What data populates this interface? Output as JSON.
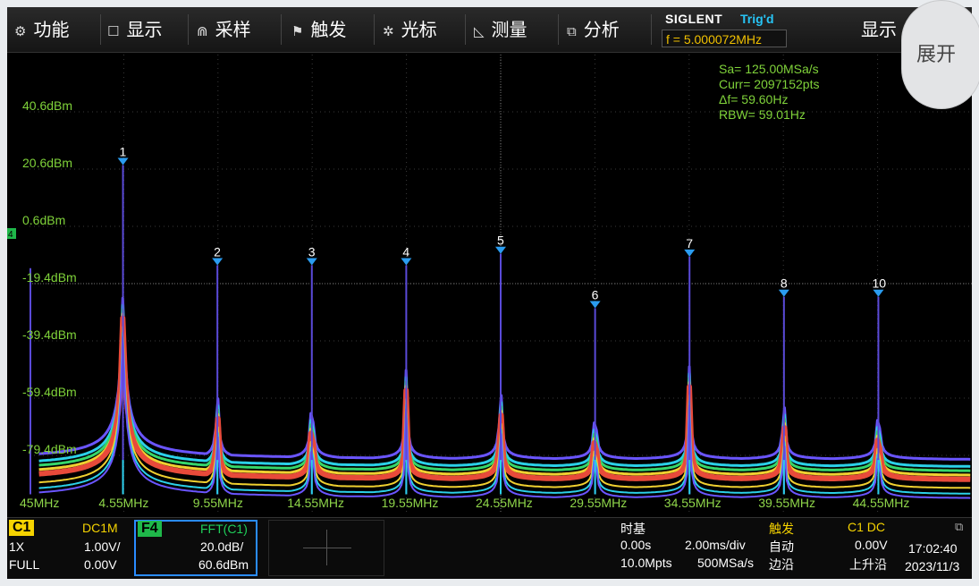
{
  "menu": {
    "items": [
      {
        "key": "function",
        "icon": "⚙",
        "label": "功能"
      },
      {
        "key": "display",
        "icon": "☐",
        "label": "显示"
      },
      {
        "key": "acquire",
        "icon": "⋒",
        "label": "采样"
      },
      {
        "key": "trigger",
        "icon": "⚑",
        "label": "触发"
      },
      {
        "key": "cursor",
        "icon": "✲",
        "label": "光标"
      },
      {
        "key": "measure",
        "icon": "◺",
        "label": "测量"
      },
      {
        "key": "analysis",
        "icon": "⧉",
        "label": "分析"
      }
    ],
    "brand": "SIGLENT",
    "trig_status": "Trig'd",
    "frequency": "f = 5.000072MHz",
    "right_label": "显示",
    "expand_label": "展开"
  },
  "fft_info": [
    "Sa= 125.00MSa/s",
    "Curr= 2097152pts",
    "Δf= 59.60Hz",
    "RBW= 59.01Hz"
  ],
  "channel_marker": "4",
  "chart_data": {
    "type": "line",
    "title": "",
    "y_labels": [
      "40.6dBm",
      "20.6dBm",
      "0.6dBm",
      "-19.4dBm",
      "-39.4dBm",
      "-59.4dBm",
      "-79.4dBm"
    ],
    "x_labels": [
      "45MHz",
      "4.55MHz",
      "9.55MHz",
      "14.55MHz",
      "19.55MHz",
      "24.55MHz",
      "29.55MHz",
      "34.55MHz",
      "39.55MHz",
      "44.55MHz"
    ],
    "ylim": [
      -99.4,
      60.6
    ],
    "xlim": [
      0.05,
      49.95
    ],
    "grid": true,
    "noise_floor_dbm": -87,
    "peaks": [
      {
        "n": "1",
        "x": 5.0,
        "y": 22
      },
      {
        "n": "2",
        "x": 10.0,
        "y": -13
      },
      {
        "n": "3",
        "x": 15.0,
        "y": -13
      },
      {
        "n": "4",
        "x": 20.0,
        "y": -13
      },
      {
        "n": "5",
        "x": 25.0,
        "y": -9
      },
      {
        "n": "6",
        "x": 30.0,
        "y": -28
      },
      {
        "n": "7",
        "x": 35.0,
        "y": -10
      },
      {
        "n": "8",
        "x": 40.0,
        "y": -24
      },
      {
        "n": "10",
        "x": 45.0,
        "y": -24
      }
    ],
    "colors": {
      "trace_low": "#e84a3a",
      "trace_mid": "#f0d030",
      "trace_green": "#36d66a",
      "trace_cyan": "#2bd0e8",
      "trace_top": "#6a55ff",
      "peak": "#5a4ad8",
      "marker": "#2a9cf0"
    }
  },
  "status": {
    "c1": {
      "tag": "C1",
      "coupling": "DC1M",
      "probe": "1X",
      "scale": "1.00V/",
      "bw": "FULL",
      "offset": "0.00V"
    },
    "f4": {
      "tag": "F4",
      "source": "FFT(C1)",
      "scale": "20.0dB/",
      "ref": "60.6dBm"
    },
    "timebase": {
      "title": "时基",
      "delay": "0.00s",
      "scale": "2.00ms/div",
      "depth": "10.0Mpts",
      "rate": "500MSa/s"
    },
    "trigger": {
      "title": "触发",
      "source": "C1 DC",
      "mode": "自动",
      "level": "0.00V",
      "type": "边沿",
      "slope": "上升沿"
    },
    "clock": {
      "time": "17:02:40",
      "date": "2023/11/3"
    }
  }
}
